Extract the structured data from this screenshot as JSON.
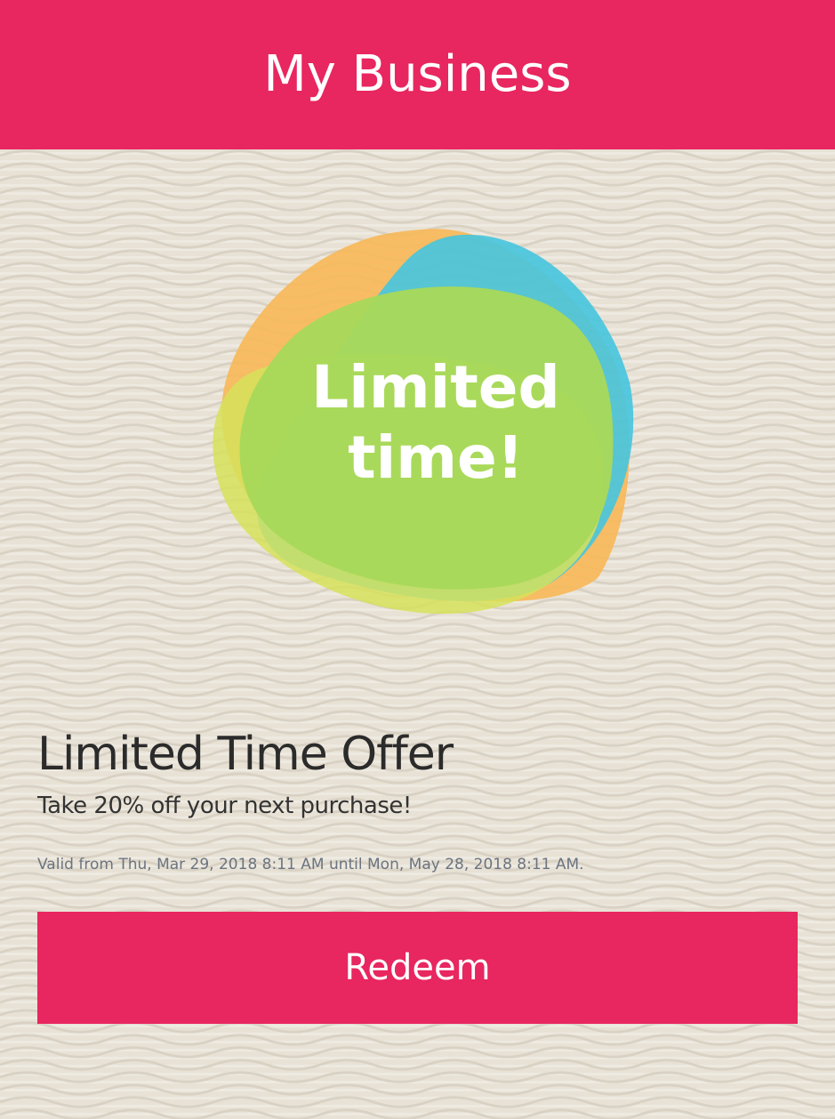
{
  "header": {
    "title": "My Business"
  },
  "badge": {
    "line1": "Limited",
    "line2": "time!",
    "colors": {
      "orange": "#f7b85a",
      "blue": "#45c5df",
      "yellow": "#d6e25a",
      "green": "#a8d85a"
    }
  },
  "offer": {
    "title": "Limited Time Offer",
    "description": "Take 20% off your next purchase!",
    "validity": "Valid from Thu, Mar 29, 2018 8:11 AM until Mon, May 28, 2018 8:11 AM."
  },
  "actions": {
    "redeem_label": "Redeem"
  },
  "colors": {
    "brand": "#e8265f",
    "background": "#e8e2d6",
    "title_text": "#2b2b2b",
    "muted_text": "#6b7480"
  }
}
